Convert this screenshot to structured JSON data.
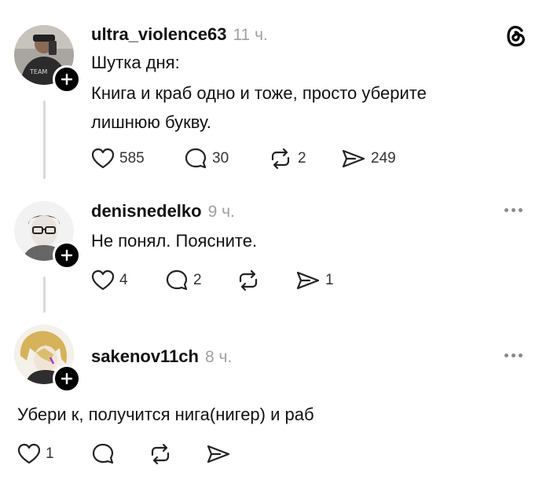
{
  "app": {
    "logo_icon": "threads-logo-icon"
  },
  "posts": [
    {
      "username": "ultra_violence63",
      "time": "11 ч.",
      "lines": [
        "Шутка дня:",
        "Книга и краб одно и тоже, просто уберите",
        "лишнюю букву."
      ],
      "likes": "585",
      "comments": "30",
      "reposts": "2",
      "shares": "249"
    },
    {
      "username": "denisnedelko",
      "time": "9 ч.",
      "lines": [
        "Не понял. Поясните."
      ],
      "likes": "4",
      "comments": "2",
      "reposts": "",
      "shares": "1"
    },
    {
      "username": "sakenov11ch",
      "time": "8 ч.",
      "lines": [
        "Убери к, получится нига(нигер) и раб"
      ],
      "likes": "1",
      "comments": "",
      "reposts": "",
      "shares": ""
    }
  ],
  "colors": {
    "text": "#111111",
    "muted": "#a0a0a0",
    "line": "#d9d9d9"
  }
}
